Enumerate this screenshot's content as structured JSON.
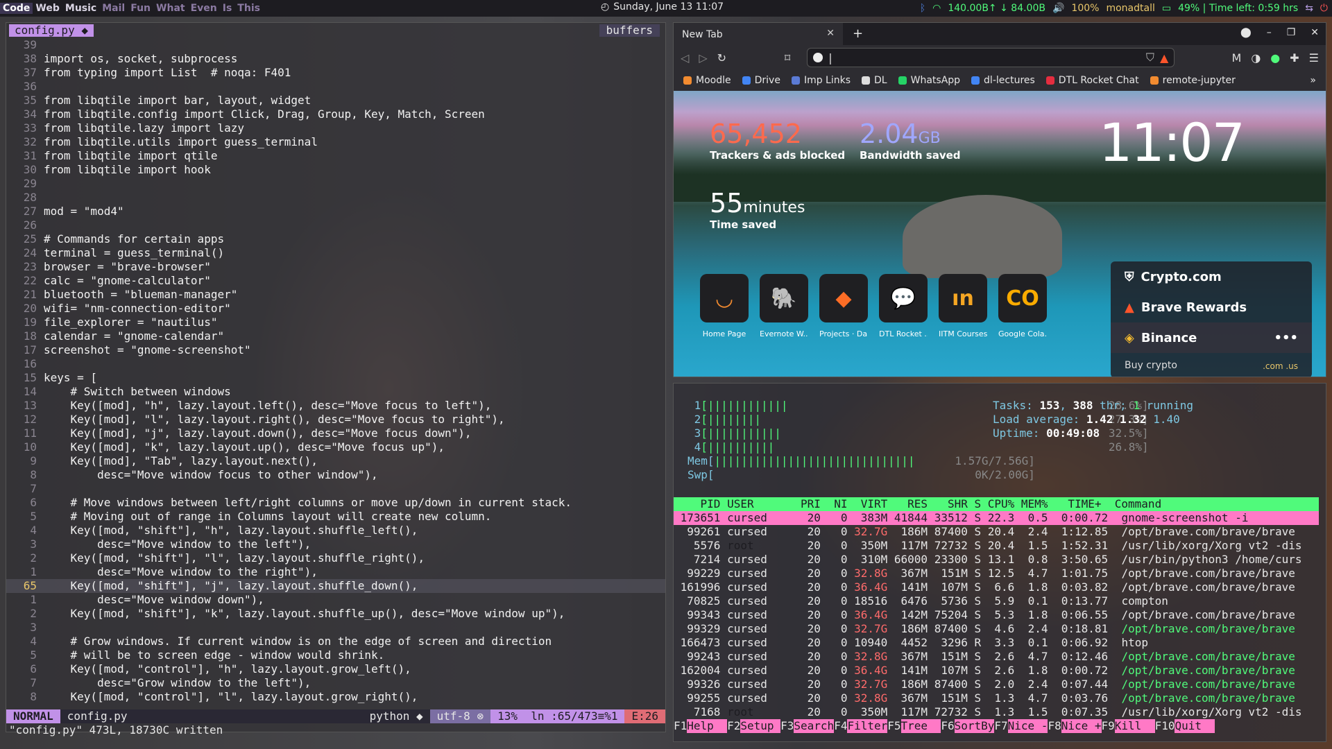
{
  "topbar": {
    "groups": [
      "Code",
      "Web",
      "Music",
      "Mail",
      "Fun",
      "What",
      "Even",
      "Is",
      "This"
    ],
    "active": "Code",
    "clock": "Sunday, June 13 11:07",
    "net": "140.00B↑ ↓ 84.00B",
    "volume": "100%",
    "wm": "monadtall",
    "battery": "49% | Time left: 0:59 hrs"
  },
  "vim": {
    "tab": "config.py ◆",
    "buffers": "buffers",
    "lines": [
      [
        "39",
        ""
      ],
      [
        "38",
        "import os, socket, subprocess"
      ],
      [
        "37",
        "from typing import List  # noqa: F401"
      ],
      [
        "36",
        ""
      ],
      [
        "35",
        "from libqtile import bar, layout, widget"
      ],
      [
        "34",
        "from libqtile.config import Click, Drag, Group, Key, Match, Screen"
      ],
      [
        "33",
        "from libqtile.lazy import lazy"
      ],
      [
        "32",
        "from libqtile.utils import guess_terminal"
      ],
      [
        "31",
        "from libqtile import qtile"
      ],
      [
        "30",
        "from libqtile import hook"
      ],
      [
        "29",
        ""
      ],
      [
        "28",
        ""
      ],
      [
        "27",
        "mod = \"mod4\""
      ],
      [
        "26",
        ""
      ],
      [
        "25",
        "# Commands for certain apps"
      ],
      [
        "24",
        "terminal = guess_terminal()"
      ],
      [
        "23",
        "browser = \"brave-browser\""
      ],
      [
        "22",
        "calc = \"gnome-calculator\""
      ],
      [
        "21",
        "bluetooth = \"blueman-manager\""
      ],
      [
        "20",
        "wifi= \"nm-connection-editor\""
      ],
      [
        "19",
        "file_explorer = \"nautilus\""
      ],
      [
        "18",
        "calendar = \"gnome-calendar\""
      ],
      [
        "17",
        "screenshot = \"gnome-screenshot\""
      ],
      [
        "16",
        ""
      ],
      [
        "15",
        "keys = ["
      ],
      [
        "14",
        "    # Switch between windows"
      ],
      [
        "13",
        "    Key([mod], \"h\", lazy.layout.left(), desc=\"Move focus to left\"),"
      ],
      [
        "12",
        "    Key([mod], \"l\", lazy.layout.right(), desc=\"Move focus to right\"),"
      ],
      [
        "11",
        "    Key([mod], \"j\", lazy.layout.down(), desc=\"Move focus down\"),"
      ],
      [
        "10",
        "    Key([mod], \"k\", lazy.layout.up(), desc=\"Move focus up\"),"
      ],
      [
        "9",
        "    Key([mod], \"Tab\", lazy.layout.next(),"
      ],
      [
        "8",
        "        desc=\"Move window focus to other window\"),"
      ],
      [
        "7",
        ""
      ],
      [
        "6",
        "    # Move windows between left/right columns or move up/down in current stack."
      ],
      [
        "5",
        "    # Moving out of range in Columns layout will create new column."
      ],
      [
        "4",
        "    Key([mod, \"shift\"], \"h\", lazy.layout.shuffle_left(),"
      ],
      [
        "3",
        "        desc=\"Move window to the left\"),"
      ],
      [
        "2",
        "    Key([mod, \"shift\"], \"l\", lazy.layout.shuffle_right(),"
      ],
      [
        "1",
        "        desc=\"Move window to the right\"),"
      ],
      [
        "65",
        "    Key([mod, \"shift\"], \"j\", lazy.layout.shuffle_down(),"
      ],
      [
        "1",
        "        desc=\"Move window down\"),"
      ],
      [
        "2",
        "    Key([mod, \"shift\"], \"k\", lazy.layout.shuffle_up(), desc=\"Move window up\"),"
      ],
      [
        "3",
        ""
      ],
      [
        "4",
        "    # Grow windows. If current window is on the edge of screen and direction"
      ],
      [
        "5",
        "    # will be to screen edge - window would shrink."
      ],
      [
        "6",
        "    Key([mod, \"control\"], \"h\", lazy.layout.grow_left(),"
      ],
      [
        "7",
        "        desc=\"Grow window to the left\"),"
      ],
      [
        "8",
        "    Key([mod, \"control\"], \"l\", lazy.layout.grow_right(),"
      ]
    ],
    "status": {
      "mode": "NORMAL",
      "file": "config.py",
      "filetype": "python ◆",
      "enc": "utf-8 ⊗",
      "pos": "13%  ln :65/473≡%1",
      "err": "E:26"
    },
    "message": "\"config.py\" 473L, 18730C written"
  },
  "browser": {
    "tab": "New Tab",
    "bookmarks": [
      "Moodle",
      "Drive",
      "Imp Links",
      "DL",
      "WhatsApp",
      "dl-lectures",
      "DTL Rocket Chat",
      "remote-jupyter"
    ],
    "stats": {
      "trackers": "65,452",
      "trackers_label": "Trackers & ads blocked",
      "bw": "2.04",
      "bw_unit": "GB",
      "bw_label": "Bandwidth saved",
      "time": "55",
      "time_unit": "minutes",
      "time_label": "Time saved"
    },
    "clock": "11:07",
    "tiles": [
      {
        "label": "Home Page",
        "color": "#f28b30",
        "glyph": "◡"
      },
      {
        "label": "Evernote W...",
        "color": "#2dbe60",
        "glyph": "🐘"
      },
      {
        "label": "Projects · Da...",
        "color": "#fc6d26",
        "glyph": "◆"
      },
      {
        "label": "DTL Rocket ...",
        "color": "#e52d3f",
        "glyph": "💬"
      },
      {
        "label": "IITM Courses",
        "color": "#f5a623",
        "glyph": "ın"
      },
      {
        "label": "Google Cola...",
        "color": "#f9ab00",
        "glyph": "CO"
      }
    ],
    "crypto": [
      "Crypto.com",
      "Brave Rewards",
      "Binance"
    ],
    "buy": "Buy crypto",
    "tld": ".com  .us"
  },
  "htop": {
    "cpus": [
      [
        "1",
        "[||||||||||||            ",
        "28.6%]"
      ],
      [
        "2",
        "[||||||||                ",
        "27.3%]"
      ],
      [
        "3",
        "[|||||||||||             ",
        "32.5%]"
      ],
      [
        "4",
        "[||||||||||              ",
        "26.8%]"
      ]
    ],
    "mem": [
      "Mem[",
      "||||||||||||||||||||||||||||||",
      "1.57G/7.56G]"
    ],
    "swp": [
      "Swp[",
      "",
      "0K/2.00G]"
    ],
    "tasks": "153",
    "thr": "388",
    "running": "1",
    "load1": "1.42",
    "load5": "1.32",
    "load15": "1.40",
    "uptime": "00:49:08",
    "header": "    PID USER       PRI  NI  VIRT   RES   SHR S CPU% MEM%   TIME+  Command",
    "rows": [
      [
        "173651",
        "cursed",
        "20",
        "0",
        "383M",
        "41844",
        "33512",
        "S",
        "22.3",
        "0.5",
        "0:00.72",
        "gnome-screenshot -i"
      ],
      [
        "99261",
        "cursed",
        "20",
        "0",
        "32.7G",
        "186M",
        "87400",
        "S",
        "20.4",
        "2.4",
        "1:12.85",
        "/opt/brave.com/brave/brave"
      ],
      [
        "5576",
        "root",
        "20",
        "0",
        "350M",
        "117M",
        "72732",
        "S",
        "20.4",
        "1.5",
        "1:52.31",
        "/usr/lib/xorg/Xorg vt2 -dis"
      ],
      [
        "7214",
        "cursed",
        "20",
        "0",
        "310M",
        "66000",
        "23300",
        "S",
        "13.1",
        "0.8",
        "3:50.65",
        "/usr/bin/python3 /home/curs"
      ],
      [
        "99229",
        "cursed",
        "20",
        "0",
        "32.8G",
        "367M",
        "151M",
        "S",
        "12.5",
        "4.7",
        "1:01.75",
        "/opt/brave.com/brave/brave"
      ],
      [
        "161996",
        "cursed",
        "20",
        "0",
        "36.4G",
        "141M",
        "107M",
        "S",
        "6.6",
        "1.8",
        "0:03.82",
        "/opt/brave.com/brave/brave"
      ],
      [
        "70825",
        "cursed",
        "20",
        "0",
        "18516",
        "6476",
        "5736",
        "S",
        "5.9",
        "0.1",
        "0:13.77",
        "compton"
      ],
      [
        "99343",
        "cursed",
        "20",
        "0",
        "36.4G",
        "142M",
        "75204",
        "S",
        "5.3",
        "1.8",
        "0:06.55",
        "/opt/brave.com/brave/brave"
      ],
      [
        "99329",
        "cursed",
        "20",
        "0",
        "32.7G",
        "186M",
        "87400",
        "S",
        "4.6",
        "2.4",
        "0:18.81",
        "/opt/brave.com/brave/brave"
      ],
      [
        "166473",
        "cursed",
        "20",
        "0",
        "10940",
        "4452",
        "3296",
        "R",
        "3.3",
        "0.1",
        "0:06.92",
        "htop"
      ],
      [
        "99243",
        "cursed",
        "20",
        "0",
        "32.8G",
        "367M",
        "151M",
        "S",
        "2.6",
        "4.7",
        "0:12.46",
        "/opt/brave.com/brave/brave"
      ],
      [
        "162004",
        "cursed",
        "20",
        "0",
        "36.4G",
        "141M",
        "107M",
        "S",
        "2.6",
        "1.8",
        "0:00.72",
        "/opt/brave.com/brave/brave"
      ],
      [
        "99326",
        "cursed",
        "20",
        "0",
        "32.7G",
        "186M",
        "87400",
        "S",
        "2.0",
        "2.4",
        "0:07.44",
        "/opt/brave.com/brave/brave"
      ],
      [
        "99255",
        "cursed",
        "20",
        "0",
        "32.8G",
        "367M",
        "151M",
        "S",
        "1.3",
        "4.7",
        "0:03.76",
        "/opt/brave.com/brave/brave"
      ],
      [
        "7168",
        "root",
        "20",
        "0",
        "350M",
        "117M",
        "72732",
        "S",
        "1.3",
        "1.5",
        "0:07.35",
        "/usr/lib/xorg/Xorg vt2 -dis"
      ]
    ],
    "footer": [
      [
        "F1",
        "Help  "
      ],
      [
        "F2",
        "Setup "
      ],
      [
        "F3",
        "Search"
      ],
      [
        "F4",
        "Filter"
      ],
      [
        "F5",
        "Tree  "
      ],
      [
        "F6",
        "SortBy"
      ],
      [
        "F7",
        "Nice -"
      ],
      [
        "F8",
        "Nice +"
      ],
      [
        "F9",
        "Kill  "
      ],
      [
        "F10",
        "Quit  "
      ]
    ]
  }
}
